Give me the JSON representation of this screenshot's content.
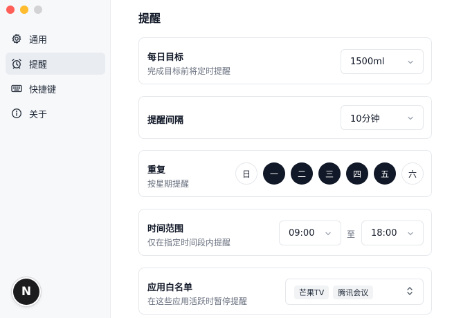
{
  "window": {
    "controls": [
      "close",
      "minimize",
      "zoom"
    ]
  },
  "sidebar": {
    "items": [
      {
        "label": "通用",
        "icon": "gear-icon",
        "active": false
      },
      {
        "label": "提醒",
        "icon": "alarm-clock-icon",
        "active": true
      },
      {
        "label": "快捷键",
        "icon": "keyboard-icon",
        "active": false
      },
      {
        "label": "关于",
        "icon": "info-icon",
        "active": false
      }
    ],
    "avatar_letter": "N"
  },
  "main": {
    "title": "提醒",
    "daily_goal": {
      "title": "每日目标",
      "desc": "完成目标前将定时提醒",
      "value": "1500ml"
    },
    "interval": {
      "title": "提醒间隔",
      "value": "10分钟"
    },
    "repeat": {
      "title": "重复",
      "desc": "按星期提醒",
      "days": [
        {
          "label": "日",
          "selected": false
        },
        {
          "label": "一",
          "selected": true
        },
        {
          "label": "二",
          "selected": true
        },
        {
          "label": "三",
          "selected": true
        },
        {
          "label": "四",
          "selected": true
        },
        {
          "label": "五",
          "selected": true
        },
        {
          "label": "六",
          "selected": false
        }
      ]
    },
    "time_range": {
      "title": "时间范围",
      "desc": "仅在指定时间段内提醒",
      "start": "09:00",
      "separator": "至",
      "end": "18:00"
    },
    "whitelist": {
      "title": "应用白名单",
      "desc": "在这些应用活跃时暂停提醒",
      "apps": [
        "芒果TV",
        "腾讯会议"
      ]
    }
  },
  "colors": {
    "accent_dark": "#111827",
    "sidebar_bg": "#f7f8fa",
    "active_item_bg": "#e9ecf1",
    "muted_text": "#6b7280",
    "border": "#e5e7eb"
  }
}
